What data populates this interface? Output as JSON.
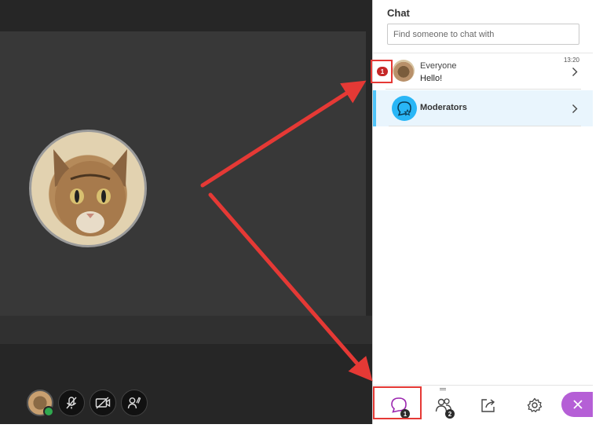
{
  "chat": {
    "title": "Chat",
    "search_placeholder": "Find someone to chat with",
    "conversations": [
      {
        "name": "Everyone",
        "last_message": "Hello!",
        "time": "13:20",
        "unread": "1"
      },
      {
        "name": "Moderators"
      }
    ]
  },
  "tabs": {
    "chat_count": "1",
    "attendees_count": "2"
  },
  "icons": {
    "user_avatar": "cat-photo",
    "microphone": "microphone-muted-icon",
    "camera": "camera-off-icon",
    "hand": "raise-hand-icon",
    "chat": "chat-icon",
    "attendees": "attendees-icon",
    "share": "share-content-icon",
    "settings": "gear-icon",
    "close": "close-icon",
    "chevron": "chevron-right-icon",
    "moderators": "moderators-chat-icon"
  },
  "colors": {
    "accent_blue": "#29b6f6",
    "close_purple": "#b55fd6",
    "unread_red": "#c62828",
    "annotation_red": "#e53935",
    "status_green": "#2fa84f"
  }
}
